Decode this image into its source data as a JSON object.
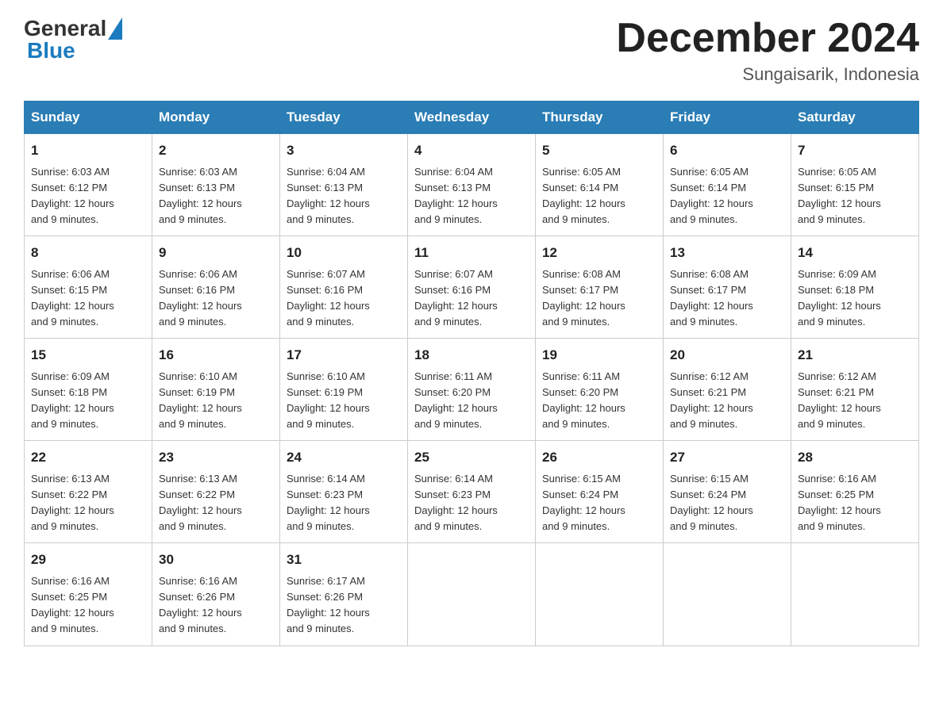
{
  "header": {
    "logo_general": "General",
    "logo_blue": "Blue",
    "month_title": "December 2024",
    "location": "Sungaisarik, Indonesia"
  },
  "days_of_week": [
    "Sunday",
    "Monday",
    "Tuesday",
    "Wednesday",
    "Thursday",
    "Friday",
    "Saturday"
  ],
  "weeks": [
    [
      {
        "day": "1",
        "sunrise": "6:03 AM",
        "sunset": "6:12 PM",
        "daylight": "12 hours and 9 minutes."
      },
      {
        "day": "2",
        "sunrise": "6:03 AM",
        "sunset": "6:13 PM",
        "daylight": "12 hours and 9 minutes."
      },
      {
        "day": "3",
        "sunrise": "6:04 AM",
        "sunset": "6:13 PM",
        "daylight": "12 hours and 9 minutes."
      },
      {
        "day": "4",
        "sunrise": "6:04 AM",
        "sunset": "6:13 PM",
        "daylight": "12 hours and 9 minutes."
      },
      {
        "day": "5",
        "sunrise": "6:05 AM",
        "sunset": "6:14 PM",
        "daylight": "12 hours and 9 minutes."
      },
      {
        "day": "6",
        "sunrise": "6:05 AM",
        "sunset": "6:14 PM",
        "daylight": "12 hours and 9 minutes."
      },
      {
        "day": "7",
        "sunrise": "6:05 AM",
        "sunset": "6:15 PM",
        "daylight": "12 hours and 9 minutes."
      }
    ],
    [
      {
        "day": "8",
        "sunrise": "6:06 AM",
        "sunset": "6:15 PM",
        "daylight": "12 hours and 9 minutes."
      },
      {
        "day": "9",
        "sunrise": "6:06 AM",
        "sunset": "6:16 PM",
        "daylight": "12 hours and 9 minutes."
      },
      {
        "day": "10",
        "sunrise": "6:07 AM",
        "sunset": "6:16 PM",
        "daylight": "12 hours and 9 minutes."
      },
      {
        "day": "11",
        "sunrise": "6:07 AM",
        "sunset": "6:16 PM",
        "daylight": "12 hours and 9 minutes."
      },
      {
        "day": "12",
        "sunrise": "6:08 AM",
        "sunset": "6:17 PM",
        "daylight": "12 hours and 9 minutes."
      },
      {
        "day": "13",
        "sunrise": "6:08 AM",
        "sunset": "6:17 PM",
        "daylight": "12 hours and 9 minutes."
      },
      {
        "day": "14",
        "sunrise": "6:09 AM",
        "sunset": "6:18 PM",
        "daylight": "12 hours and 9 minutes."
      }
    ],
    [
      {
        "day": "15",
        "sunrise": "6:09 AM",
        "sunset": "6:18 PM",
        "daylight": "12 hours and 9 minutes."
      },
      {
        "day": "16",
        "sunrise": "6:10 AM",
        "sunset": "6:19 PM",
        "daylight": "12 hours and 9 minutes."
      },
      {
        "day": "17",
        "sunrise": "6:10 AM",
        "sunset": "6:19 PM",
        "daylight": "12 hours and 9 minutes."
      },
      {
        "day": "18",
        "sunrise": "6:11 AM",
        "sunset": "6:20 PM",
        "daylight": "12 hours and 9 minutes."
      },
      {
        "day": "19",
        "sunrise": "6:11 AM",
        "sunset": "6:20 PM",
        "daylight": "12 hours and 9 minutes."
      },
      {
        "day": "20",
        "sunrise": "6:12 AM",
        "sunset": "6:21 PM",
        "daylight": "12 hours and 9 minutes."
      },
      {
        "day": "21",
        "sunrise": "6:12 AM",
        "sunset": "6:21 PM",
        "daylight": "12 hours and 9 minutes."
      }
    ],
    [
      {
        "day": "22",
        "sunrise": "6:13 AM",
        "sunset": "6:22 PM",
        "daylight": "12 hours and 9 minutes."
      },
      {
        "day": "23",
        "sunrise": "6:13 AM",
        "sunset": "6:22 PM",
        "daylight": "12 hours and 9 minutes."
      },
      {
        "day": "24",
        "sunrise": "6:14 AM",
        "sunset": "6:23 PM",
        "daylight": "12 hours and 9 minutes."
      },
      {
        "day": "25",
        "sunrise": "6:14 AM",
        "sunset": "6:23 PM",
        "daylight": "12 hours and 9 minutes."
      },
      {
        "day": "26",
        "sunrise": "6:15 AM",
        "sunset": "6:24 PM",
        "daylight": "12 hours and 9 minutes."
      },
      {
        "day": "27",
        "sunrise": "6:15 AM",
        "sunset": "6:24 PM",
        "daylight": "12 hours and 9 minutes."
      },
      {
        "day": "28",
        "sunrise": "6:16 AM",
        "sunset": "6:25 PM",
        "daylight": "12 hours and 9 minutes."
      }
    ],
    [
      {
        "day": "29",
        "sunrise": "6:16 AM",
        "sunset": "6:25 PM",
        "daylight": "12 hours and 9 minutes."
      },
      {
        "day": "30",
        "sunrise": "6:16 AM",
        "sunset": "6:26 PM",
        "daylight": "12 hours and 9 minutes."
      },
      {
        "day": "31",
        "sunrise": "6:17 AM",
        "sunset": "6:26 PM",
        "daylight": "12 hours and 9 minutes."
      },
      null,
      null,
      null,
      null
    ]
  ],
  "labels": {
    "sunrise": "Sunrise:",
    "sunset": "Sunset:",
    "daylight": "Daylight:"
  }
}
